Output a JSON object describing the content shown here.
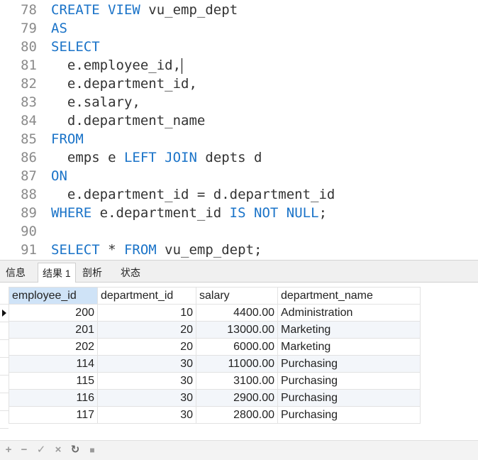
{
  "editor": {
    "lines": [
      {
        "num": "78",
        "parts": [
          {
            "t": "CREATE",
            "k": 1
          },
          {
            "t": " "
          },
          {
            "t": "VIEW",
            "k": 1
          },
          {
            "t": " vu_emp_dept"
          }
        ]
      },
      {
        "num": "79",
        "parts": [
          {
            "t": "AS",
            "k": 1
          }
        ]
      },
      {
        "num": "80",
        "parts": [
          {
            "t": "SELECT",
            "k": 1
          }
        ]
      },
      {
        "num": "81",
        "parts": [
          {
            "t": "  e.employee_id,"
          }
        ],
        "caret": true
      },
      {
        "num": "82",
        "parts": [
          {
            "t": "  e.department_id,"
          }
        ]
      },
      {
        "num": "83",
        "parts": [
          {
            "t": "  e.salary,"
          }
        ]
      },
      {
        "num": "84",
        "parts": [
          {
            "t": "  d.department_name"
          }
        ]
      },
      {
        "num": "85",
        "parts": [
          {
            "t": "FROM",
            "k": 1
          }
        ]
      },
      {
        "num": "86",
        "parts": [
          {
            "t": "  emps e "
          },
          {
            "t": "LEFT",
            "k": 1
          },
          {
            "t": " "
          },
          {
            "t": "JOIN",
            "k": 1
          },
          {
            "t": " depts d"
          }
        ]
      },
      {
        "num": "87",
        "parts": [
          {
            "t": "ON",
            "k": 1
          }
        ]
      },
      {
        "num": "88",
        "parts": [
          {
            "t": "  e.department_id = d.department_id"
          }
        ]
      },
      {
        "num": "89",
        "parts": [
          {
            "t": "WHERE",
            "k": 1
          },
          {
            "t": " e.department_id "
          },
          {
            "t": "IS",
            "k": 1
          },
          {
            "t": " "
          },
          {
            "t": "NOT",
            "k": 1
          },
          {
            "t": " "
          },
          {
            "t": "NULL",
            "k": 1
          },
          {
            "t": ";"
          }
        ]
      },
      {
        "num": "90",
        "parts": []
      },
      {
        "num": "91",
        "parts": [
          {
            "t": "SELECT",
            "k": 1
          },
          {
            "t": " * "
          },
          {
            "t": "FROM",
            "k": 1
          },
          {
            "t": " vu_emp_dept;"
          }
        ]
      }
    ]
  },
  "tabs": [
    {
      "label": "信息",
      "active": false
    },
    {
      "label": "结果 1",
      "active": true
    },
    {
      "label": "剖析",
      "active": false
    },
    {
      "label": "状态",
      "active": false
    }
  ],
  "grid": {
    "columns": [
      "employee_id",
      "department_id",
      "salary",
      "department_name"
    ],
    "rows": [
      [
        "200",
        "10",
        "4400.00",
        "Administration"
      ],
      [
        "201",
        "20",
        "13000.00",
        "Marketing"
      ],
      [
        "202",
        "20",
        "6000.00",
        "Marketing"
      ],
      [
        "114",
        "30",
        "11000.00",
        "Purchasing"
      ],
      [
        "115",
        "30",
        "3100.00",
        "Purchasing"
      ],
      [
        "116",
        "30",
        "2900.00",
        "Purchasing"
      ],
      [
        "117",
        "30",
        "2800.00",
        "Purchasing"
      ]
    ]
  },
  "toolbar": {
    "add": "+",
    "delete": "−",
    "apply": "✓",
    "cancel": "×",
    "refresh": "↻",
    "stop": "■"
  },
  "colors": {
    "keyword": "#1a73c8",
    "selected_header": "#cfe3f7",
    "alt_row": "#f3f6fa"
  }
}
